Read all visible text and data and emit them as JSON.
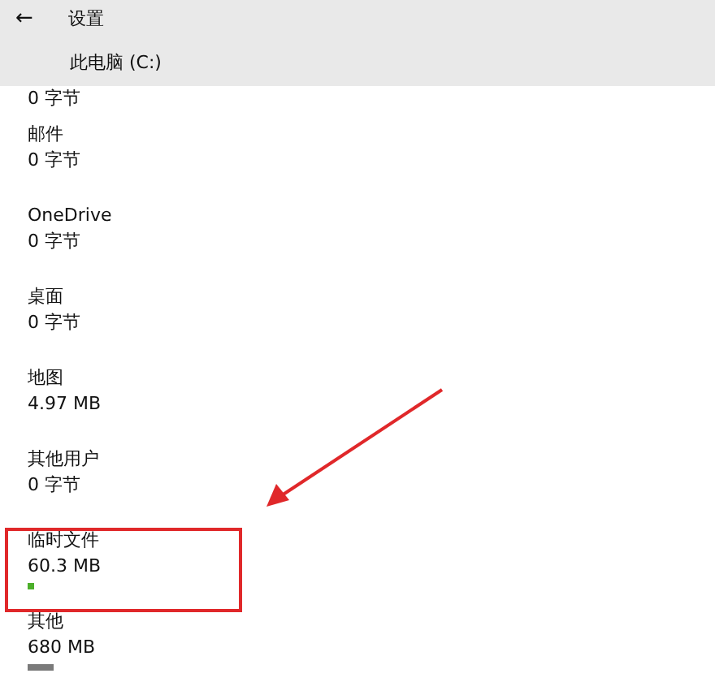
{
  "window": {
    "back": "←",
    "title": "设置"
  },
  "drive": {
    "name": "此电脑 (C:)",
    "size": "0 字节"
  },
  "categories": [
    {
      "name": "邮件",
      "size": "0 字节",
      "highlighted": false
    },
    {
      "name": "OneDrive",
      "size": "0 字节",
      "highlighted": false
    },
    {
      "name": "桌面",
      "size": "0 字节",
      "highlighted": false
    },
    {
      "name": "地图",
      "size": "4.97 MB",
      "highlighted": false
    },
    {
      "name": "其他用户",
      "size": "0 字节",
      "highlighted": false
    },
    {
      "name": "临时文件",
      "size": "60.3 MB",
      "level": 0.01,
      "color": "#4caf2a",
      "highlighted": true
    },
    {
      "name": "其他",
      "size": "680 MB",
      "level": 0.08,
      "color": "#7a7a7a",
      "highlighted": false
    }
  ]
}
